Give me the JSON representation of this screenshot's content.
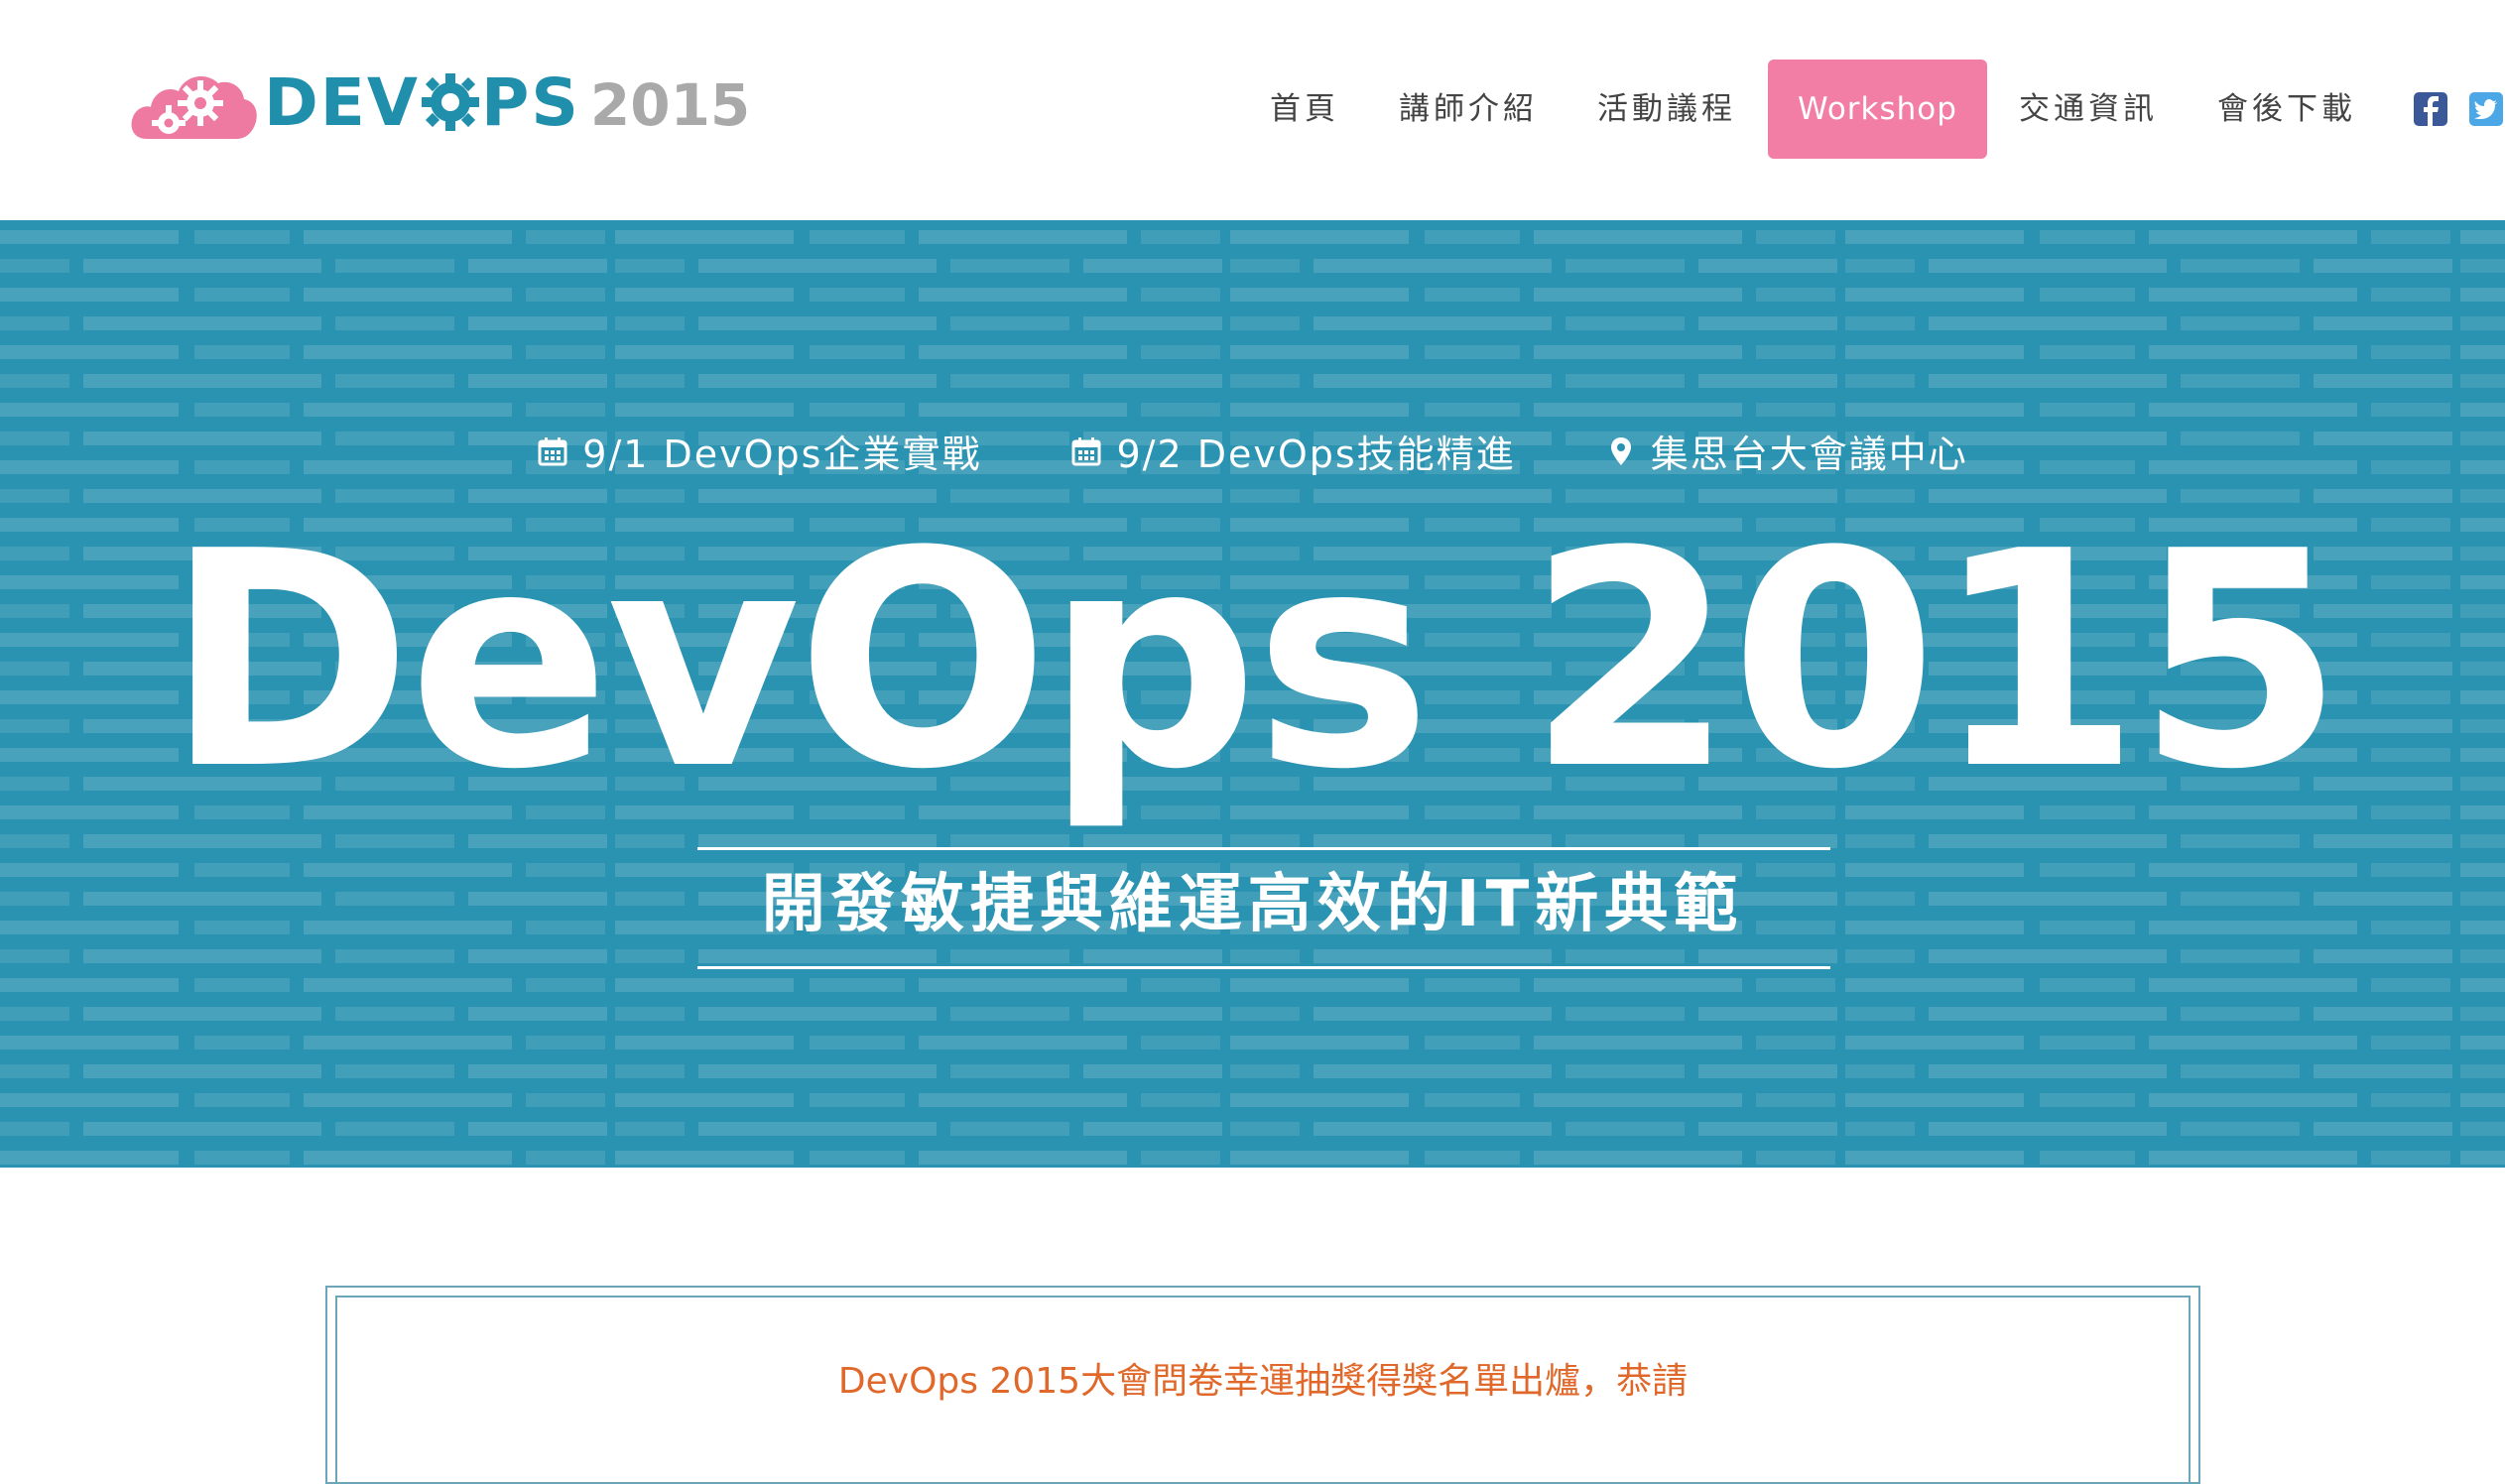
{
  "header": {
    "logo": {
      "dev": "DEV",
      "ps": "PS",
      "year": "2015"
    },
    "nav": [
      {
        "label": "首頁"
      },
      {
        "label": "講師介紹"
      },
      {
        "label": "活動議程"
      },
      {
        "label": "Workshop",
        "active": true
      },
      {
        "label": "交通資訊"
      },
      {
        "label": "會後下載"
      }
    ],
    "social": [
      "facebook-icon",
      "twitter-icon"
    ]
  },
  "banner": {
    "events": [
      {
        "icon": "calendar-icon",
        "text": "9/1 DevOps企業實戰"
      },
      {
        "icon": "calendar-icon",
        "text": "9/2 DevOps技能精進"
      },
      {
        "icon": "map-marker-icon",
        "text": "集思台大會議中心"
      }
    ],
    "title": "DevOps 2015",
    "subtitle": "開發敏捷與維運高效的IT新典範"
  },
  "announcement": {
    "text": "DevOps 2015大會問卷幸運抽獎得獎名單出爐，恭請"
  },
  "colors": {
    "brand": "#1f8fac",
    "accent_pink": "#f27ea6",
    "banner_bg": "#2a93b1",
    "announcement": "#e0682a"
  }
}
